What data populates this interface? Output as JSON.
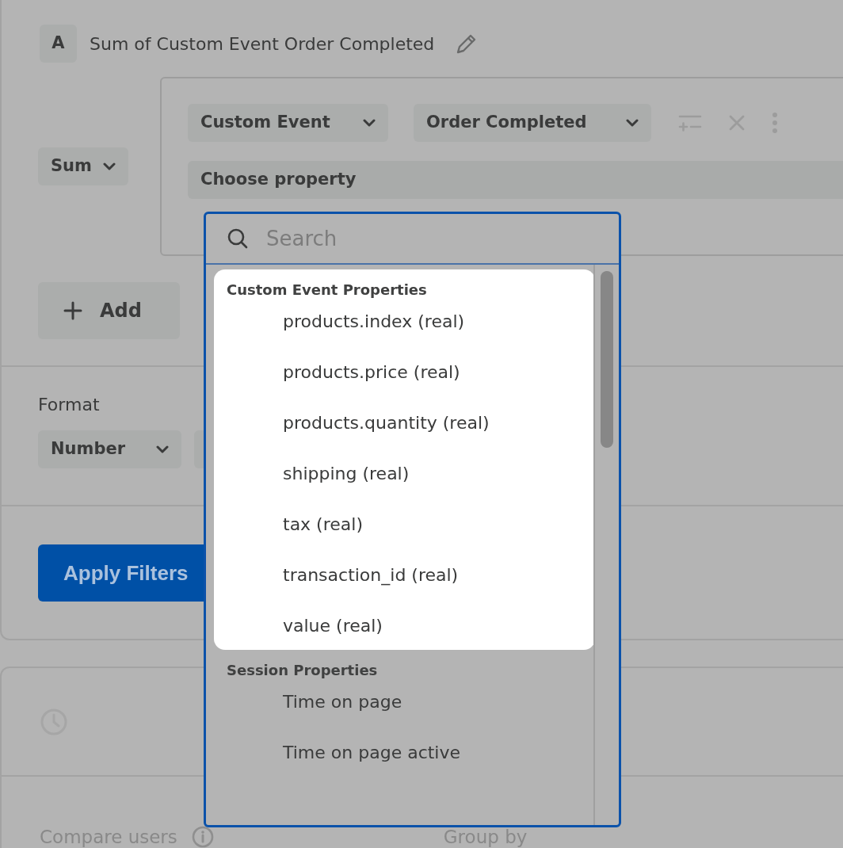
{
  "header": {
    "badge": "A",
    "title": "Sum of Custom Event Order Completed"
  },
  "metric": {
    "aggregate": "Sum",
    "event_type": "Custom Event",
    "event": "Order Completed",
    "property": "Choose property"
  },
  "add_button": "Add",
  "format": {
    "label": "Format",
    "type": "Number"
  },
  "apply_button": "Apply Filters",
  "compare": {
    "label": "Compare users",
    "group_by": "Group by"
  },
  "dropdown": {
    "search": {
      "placeholder": "Search"
    },
    "groups": [
      {
        "title": "Custom Event Properties",
        "highlighted": true,
        "items": [
          "products.index (real)",
          "products.price (real)",
          "products.quantity (real)",
          "shipping (real)",
          "tax (real)",
          "transaction_id (real)",
          "value (real)"
        ]
      },
      {
        "title": "Session Properties",
        "highlighted": false,
        "items": [
          "Time on page",
          "Time on page active"
        ]
      }
    ]
  }
}
